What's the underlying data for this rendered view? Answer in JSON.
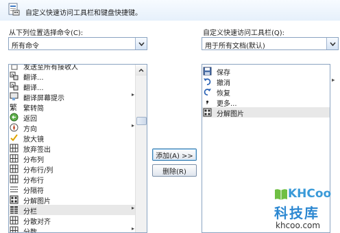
{
  "header": {
    "title": "自定义快速访问工具栏和键盘快捷键。"
  },
  "left": {
    "label": "从下列位置选择命令(C):",
    "combo_value": "所有命令",
    "items": [
      {
        "icon": "page-icon",
        "label": "发送至所有接收人",
        "arrow": false
      },
      {
        "icon": "translate-icon",
        "label": "翻译...",
        "arrow": false
      },
      {
        "icon": "translate-icon",
        "label": "翻译...",
        "arrow": false
      },
      {
        "icon": "screen-tip-icon",
        "label": "翻译屏幕提示",
        "arrow": true
      },
      {
        "icon": "convert-icon",
        "label": "繁转简",
        "arrow": false
      },
      {
        "icon": "return-icon",
        "label": "返回",
        "arrow": false
      },
      {
        "icon": "direction-icon",
        "label": "方向",
        "arrow": true
      },
      {
        "icon": "check-icon",
        "label": "放大镜",
        "arrow": false
      },
      {
        "icon": "grid-icon",
        "label": "放弃签出",
        "arrow": false
      },
      {
        "icon": "grid-icon",
        "label": "分布列",
        "arrow": false
      },
      {
        "icon": "grid-icon",
        "label": "分布行/列",
        "arrow": false
      },
      {
        "icon": "grid-icon",
        "label": "分布行",
        "arrow": false
      },
      {
        "icon": "separator-icon",
        "label": "分隔符",
        "arrow": false
      },
      {
        "icon": "split-picture-icon",
        "label": "分解图片",
        "arrow": false
      },
      {
        "icon": "columns-icon",
        "label": "分栏",
        "arrow": true,
        "selected": true
      },
      {
        "icon": "grid-icon",
        "label": "分散对齐",
        "arrow": false
      },
      {
        "icon": "grid-icon",
        "label": "分数",
        "arrow": true
      }
    ]
  },
  "buttons": {
    "add": "添加(A) >>",
    "remove": "删除(R)"
  },
  "right": {
    "label": "自定义快速访问工具栏(Q):",
    "combo_value": "用于所有文档(默认)",
    "items": [
      {
        "icon": "save-icon",
        "label": "保存"
      },
      {
        "icon": "undo-icon",
        "label": "撤消"
      },
      {
        "icon": "redo-icon",
        "label": "恢复"
      },
      {
        "icon": "more-icon",
        "label": "更多..."
      },
      {
        "icon": "split-picture-icon",
        "label": "分解图片",
        "selected": true
      }
    ]
  },
  "watermark": {
    "logo": "KHCoo",
    "cn": "科技库",
    "url": "khcoo.com"
  }
}
